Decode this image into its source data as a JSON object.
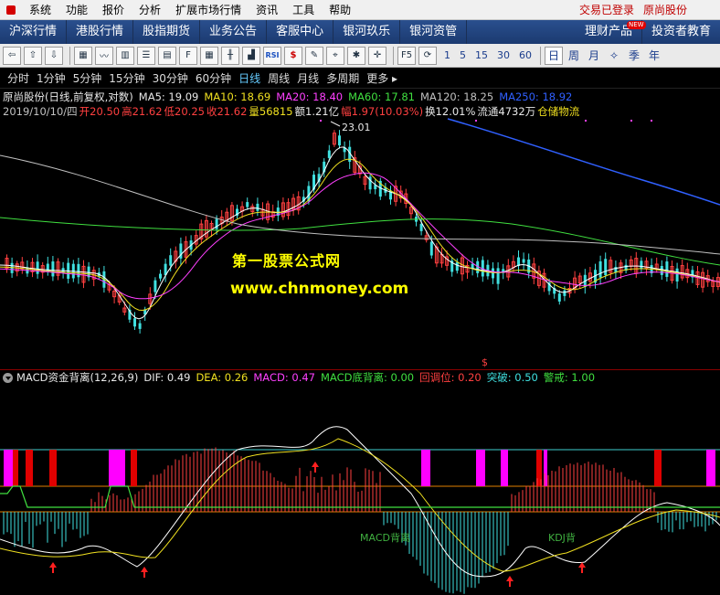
{
  "menubar": {
    "items": [
      "系统",
      "功能",
      "报价",
      "分析",
      "扩展市场行情",
      "资讯",
      "工具",
      "帮助"
    ],
    "status_login": "交易已登录",
    "status_stock": "原尚股份"
  },
  "navbar": {
    "items": [
      "沪深行情",
      "港股行情",
      "股指期货",
      "业务公告",
      "客服中心",
      "银河玖乐",
      "银河资管"
    ],
    "right_items": [
      "理财产品",
      "投资者教育"
    ],
    "badge": "NEW"
  },
  "toolbar": {
    "numbers": [
      "1",
      "5",
      "15",
      "30",
      "60"
    ],
    "periods": [
      "日",
      "周",
      "月",
      "年",
      "季",
      "年"
    ],
    "active_period": "日"
  },
  "periodbar": {
    "items": [
      "分时",
      "1分钟",
      "5分钟",
      "15分钟",
      "30分钟",
      "60分钟",
      "日线",
      "周线",
      "月线",
      "多周期",
      "更多"
    ],
    "active": "日线"
  },
  "chart_header": {
    "title": "原尚股份(日线,前复权,对数)",
    "ma5": "MA5: 19.09",
    "ma10": "MA10: 18.69",
    "ma20": "MA20: 18.40",
    "ma60": "MA60: 17.81",
    "ma120": "MA120: 18.25",
    "ma250": "MA250: 18.92"
  },
  "quote_line": {
    "date": "2019/10/10/四",
    "open": "开20.50",
    "high": "高21.62",
    "low": "低20.25",
    "close": "收21.62",
    "volume": "量56815",
    "amount": "额1.21亿",
    "change": "幅1.97(10.03%)",
    "turnover": "换12.01%",
    "float": "流通4732万",
    "sector": "仓储物流"
  },
  "annotations": {
    "peak": "23.01",
    "watermark_title": "第一股票公式网",
    "watermark_url": "www.chnmoney.com",
    "dollar": "$"
  },
  "indicator": {
    "name": "MACD资金背离(12,26,9)",
    "dif": "DIF: 0.49",
    "dea": "DEA: 0.26",
    "macd": "MACD: 0.47",
    "macd_divergence": "MACD底背离: 0.00",
    "pullback": "回调位: 0.20",
    "breakout": "突破: 0.50",
    "alert": "警戒: 1.00",
    "macd_label": "MACD背离",
    "kdj_label": "KDJ背"
  },
  "colors": {
    "up": "#ff4040",
    "down": "#40e0e0",
    "ma5": "#ffffff",
    "ma10": "#f0e020",
    "ma20": "#ff40ff",
    "ma60": "#40e040",
    "ma120": "#c0c0c0",
    "ma250": "#3060ff"
  }
}
